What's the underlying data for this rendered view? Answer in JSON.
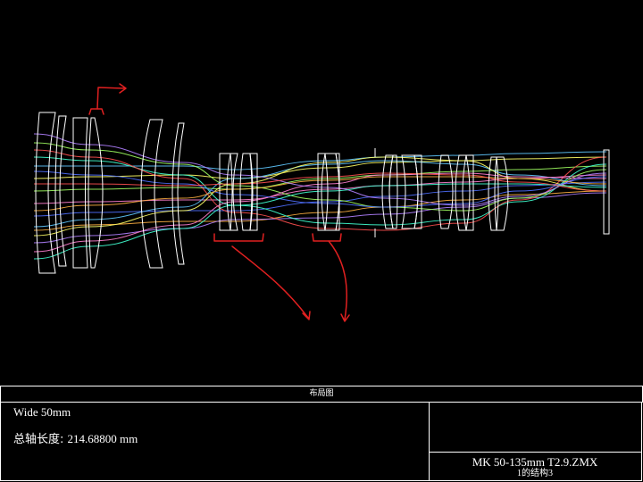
{
  "layout_title": "布局图",
  "title_block": {
    "configuration_label": "Wide 50mm",
    "axial_length_label": "总轴长度:",
    "axial_length_value": "214.68800 mm",
    "file_name": "MK 50-135mm T2.9.ZMX",
    "config_info": "1的结构3"
  },
  "colors": {
    "background": "#000000",
    "lens_outline": "#ffffff",
    "annotation": "#e02020",
    "ray_colors": [
      "#5fc8ff",
      "#ffff66",
      "#a0ff60",
      "#ff7fd0",
      "#4f6fff",
      "#ffb040",
      "#b080ff",
      "#40ffd0",
      "#ff5050"
    ]
  },
  "annotations": [
    "bracket-group-1",
    "arrow-group-1",
    "bracket-group-2",
    "arrow-group-2",
    "bracket-group-3",
    "arrow-group-3"
  ]
}
